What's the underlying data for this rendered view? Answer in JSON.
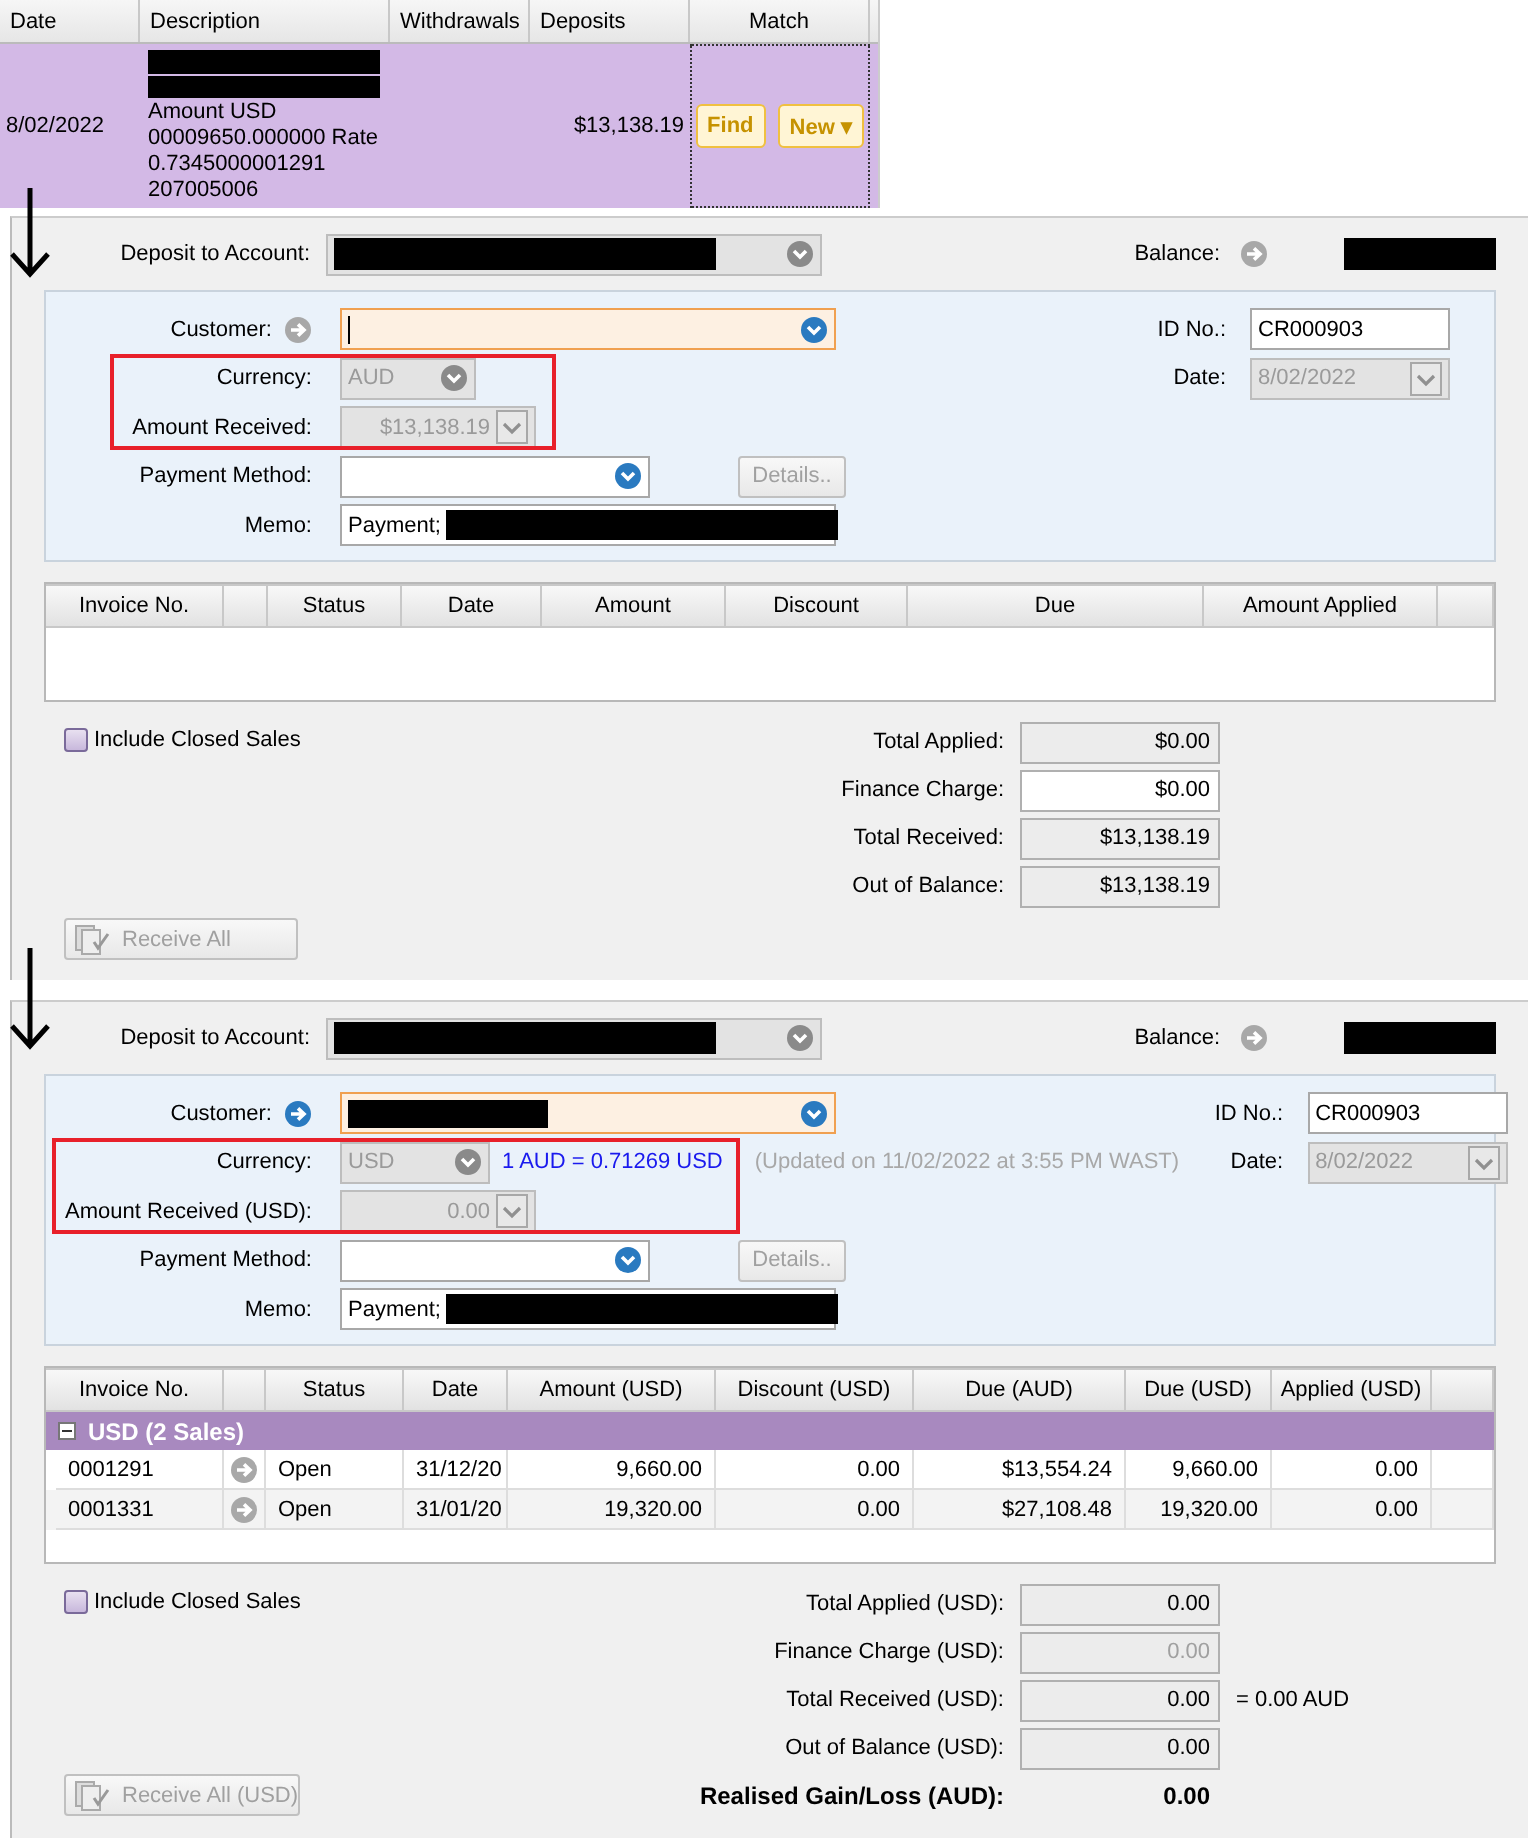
{
  "bank_feed": {
    "columns": [
      "Date",
      "Description",
      "Withdrawals",
      "Deposits",
      "Match"
    ],
    "row": {
      "date": "8/02/2022",
      "description_redacted": true,
      "description_lines": [
        "Amount USD",
        "00009650.000000 Rate",
        "0.7345000001291",
        "207005006"
      ],
      "deposit": "$13,138.19",
      "selected": true,
      "buttons": [
        "Find",
        "New ▾"
      ]
    }
  },
  "forms": [
    {
      "deposit_label": "Deposit to Account:",
      "deposit_redacted": true,
      "balance_label": "Balance:",
      "balance_redacted": true,
      "customer": {
        "label": "Customer:",
        "filled": false,
        "focused": true
      },
      "currency": {
        "label": "Currency:",
        "value": "AUD",
        "disabled": true
      },
      "amount": {
        "label": "Amount Received:",
        "value": "$13,138.19",
        "disabled": true
      },
      "highlight": true,
      "payment_method": {
        "label": "Payment Method:"
      },
      "details_button": {
        "label": "Details..",
        "disabled": true
      },
      "memo": {
        "label": "Memo:",
        "value": "Payment;",
        "redacted": true
      },
      "id": {
        "label": "ID No.:",
        "value": "CR000903"
      },
      "date": {
        "label": "Date:",
        "value": "8/02/2022",
        "disabled": true
      },
      "columns": [
        "Invoice No.",
        "Status",
        "Date",
        "Amount",
        "Discount",
        "Due",
        "Amount Applied"
      ],
      "include_closed": {
        "label": "Include Closed Sales",
        "checked": false
      },
      "totals": [
        {
          "label": "Total Applied:",
          "value": "$0.00",
          "kind": "readonly"
        },
        {
          "label": "Finance Charge:",
          "value": "$0.00",
          "kind": "editable"
        },
        {
          "label": "Total Received:",
          "value": "$13,138.19",
          "kind": "readonly"
        },
        {
          "label": "Out of Balance:",
          "value": "$13,138.19",
          "kind": "readonly"
        }
      ],
      "receive_all": {
        "label": "Receive All",
        "disabled": true
      }
    },
    {
      "deposit_label": "Deposit to Account:",
      "deposit_redacted": true,
      "balance_label": "Balance:",
      "balance_redacted": true,
      "customer": {
        "label": "Customer:",
        "filled": true,
        "focused": false
      },
      "currency": {
        "label": "Currency:",
        "value": "USD",
        "disabled": true
      },
      "rate": "1 AUD = 0.71269 USD",
      "rate_note": "(Updated on 11/02/2022 at 3:55 PM WAST)",
      "amount": {
        "label": "Amount Received (USD):",
        "value": "0.00",
        "disabled": true
      },
      "highlight": true,
      "payment_method": {
        "label": "Payment Method:"
      },
      "details_button": {
        "label": "Details..",
        "disabled": true
      },
      "memo": {
        "label": "Memo:",
        "value": "Payment;",
        "redacted": true
      },
      "id": {
        "label": "ID No.:",
        "value": "CR000903"
      },
      "date": {
        "label": "Date:",
        "value": "8/02/2022",
        "disabled": true
      },
      "columns": [
        "Invoice No.",
        "Status",
        "Date",
        "Amount (USD)",
        "Discount (USD)",
        "Due (AUD)",
        "Due (USD)",
        "Applied (USD)"
      ],
      "group": {
        "label": "USD (2 Sales)",
        "expanded": true
      },
      "rows": [
        {
          "cells": [
            "0001291",
            "Open",
            "31/12/20",
            "9,660.00",
            "0.00",
            "$13,554.24",
            "9,660.00",
            "0.00"
          ]
        },
        {
          "cells": [
            "0001331",
            "Open",
            "31/01/20",
            "19,320.00",
            "0.00",
            "$27,108.48",
            "19,320.00",
            "0.00"
          ]
        }
      ],
      "include_closed": {
        "label": "Include Closed Sales",
        "checked": false
      },
      "totals": [
        {
          "label": "Total Applied (USD):",
          "value": "0.00",
          "kind": "readonly"
        },
        {
          "label": "Finance Charge (USD):",
          "value": "0.00",
          "kind": "disabled"
        },
        {
          "label": "Total Received (USD):",
          "value": "0.00",
          "kind": "readonly",
          "suffix": "= 0.00 AUD"
        },
        {
          "label": "Out of Balance (USD):",
          "value": "0.00",
          "kind": "readonly"
        }
      ],
      "gain_loss": {
        "label": "Realised Gain/Loss (AUD):",
        "value": "0.00"
      },
      "receive_all": {
        "label": "Receive All (USD)",
        "disabled": true
      }
    }
  ]
}
